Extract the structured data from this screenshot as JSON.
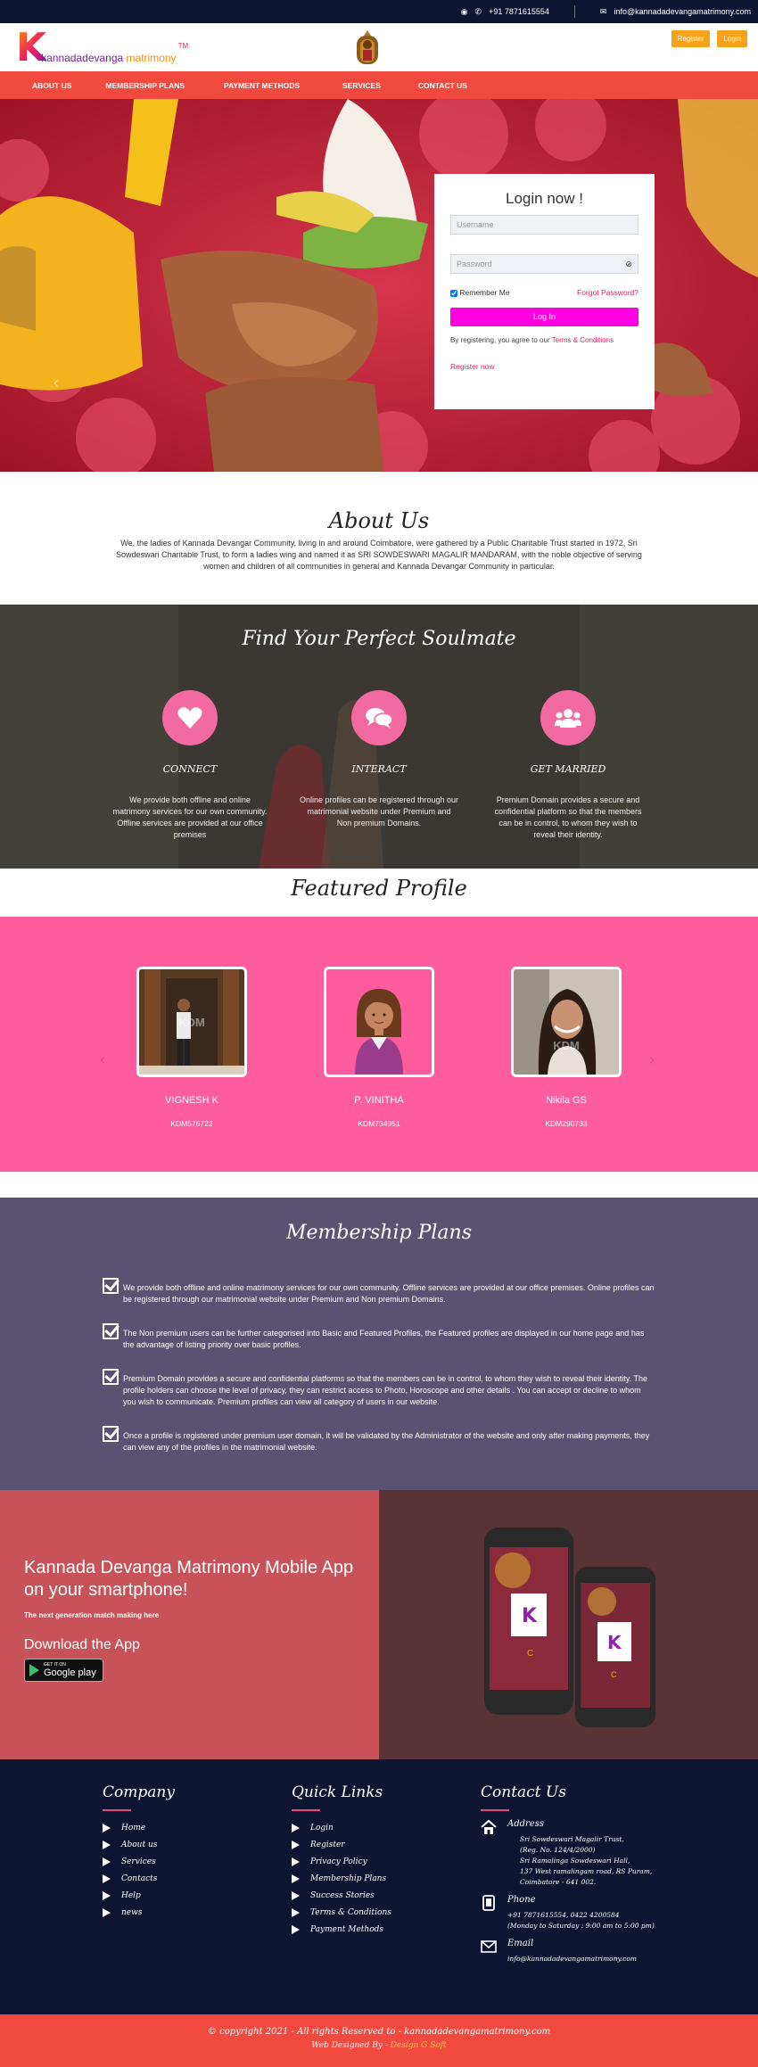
{
  "topbar": {
    "phone": "+91 7871615554",
    "email": "info@kannadadevangamatrimony.com"
  },
  "header": {
    "logo_k": "K",
    "logo_brand": "kannadadevanga",
    "logo_suffix": "matrimony",
    "logo_tm": "TM",
    "register_label": "Register",
    "login_label": "Login"
  },
  "nav": {
    "items": [
      "ABOUT US",
      "MEMBERSHIP PLANS",
      "PAYMENT METHODS",
      "SERVICES",
      "CONTACT US"
    ]
  },
  "login": {
    "title": "Login now !",
    "username_placeholder": "Username",
    "password_placeholder": "Password",
    "remember_label": "Remember Me",
    "forgot_label": "Forgot Password?",
    "login_button": "Log In",
    "terms_prefix": "By registering, you agree to our ",
    "terms_link": "Terms & Conditions",
    "register_now": "Register now"
  },
  "about": {
    "title": "About Us",
    "text": "We, the ladies of Kannada Devangar Community, living in and around Coimbatore, were gathered by a Public Charitable Trust started in 1972, Sri Sowdeswari Charitable Trust, to form a ladies wing and named it as SRI SOWDESWARI MAGALIR MANDARAM, with the noble objective of serving women and children of all communities in general and Kannada Devangar Community in particular."
  },
  "soulmate": {
    "title": "Find Your Perfect Soulmate",
    "features": [
      {
        "icon": "heart-icon",
        "title": "CONNECT",
        "text": "We provide both offline and online matrimony services for our own community. Offline services are provided at our office premises"
      },
      {
        "icon": "chat-icon",
        "title": "INTERACT",
        "text": "Online profiles can be registered through our matrimonial website under Premium and Non premium Domains."
      },
      {
        "icon": "users-icon",
        "title": "GET MARRIED",
        "text": "Premium Domain provides a secure and confidential platform so that the members can be in control, to whom they wish to reveal their identity."
      }
    ]
  },
  "featured": {
    "title": "Featured Profile",
    "watermark": "KDM",
    "profiles": [
      {
        "name": "VIGNESH K",
        "id": "KDM576722"
      },
      {
        "name": "P. VINITHA",
        "id": "KDM734951"
      },
      {
        "name": "Nikila GS",
        "id": "KDM290733"
      }
    ]
  },
  "membership": {
    "title": "Membership Plans",
    "items": [
      "We provide both offline and online matrimony services for our own community. Offline services are provided at our office premises. Online profiles can be registered through our matrimonial website under Premium and Non premium Domains.",
      "The Non premium users can be further categorised into Basic and Featured Profiles, the Featured profiles are displayed in our home page and has the advantage of listing priority over basic profiles.",
      "Premium Domain provides a secure and confidential platforms so that the members can be in control, to whom they wish to reveal their identity. The profile holders can choose the level of privacy, they can restrict access to Photo, Horoscope and other details . You can accept or decline to whom you wish to communicate. Premium profiles can view all category of users in our website.",
      "Once a profile is registered under premium user domain, it will be validated by the Administrator of the website and only after making payments, they can view any of the profiles in the matrimonial website."
    ]
  },
  "app": {
    "title_line1": "Kannada Devanga Matrimony Mobile App",
    "title_line2": "on your smartphone!",
    "subtitle": "The next generation match making here",
    "download": "Download the App",
    "gplay_small": "GET IT ON",
    "gplay_big": "Google play"
  },
  "footer": {
    "company": {
      "title": "Company",
      "links": [
        "Home",
        "About us",
        "Services",
        "Contacts",
        "Help",
        "news"
      ]
    },
    "quick": {
      "title": "Quick Links",
      "links": [
        "Login",
        "Register",
        "Privacy Policy",
        "Membership Plans",
        "Success Stories",
        "Terms & Conditions",
        "Payment Methods"
      ]
    },
    "contact": {
      "title": "Contact Us",
      "address_label": "Address",
      "address_lines": [
        "Sri Sowdeswari Magalir Trust,",
        "(Reg. No. 124/4/2000)",
        "Sri Ramalinga Sowdeswari Hall,",
        "137 West ramalingam road, RS Puram,",
        "Coimbatore - 641 002."
      ],
      "phone_label": "Phone",
      "phone_lines": [
        "+91 7871615554, 0422 4200584",
        "(Monday to Saturday : 9:00 am to 5:00 pm)"
      ],
      "email_label": "Email",
      "email": "info@kannadadevangamatrimony.com"
    }
  },
  "copyright": {
    "text": "© copyright 2021 - All rights Reserved to - kannadadevangamatrimony.com",
    "designed_prefix": "Web Designed By - ",
    "designer": "Design G Soft"
  }
}
